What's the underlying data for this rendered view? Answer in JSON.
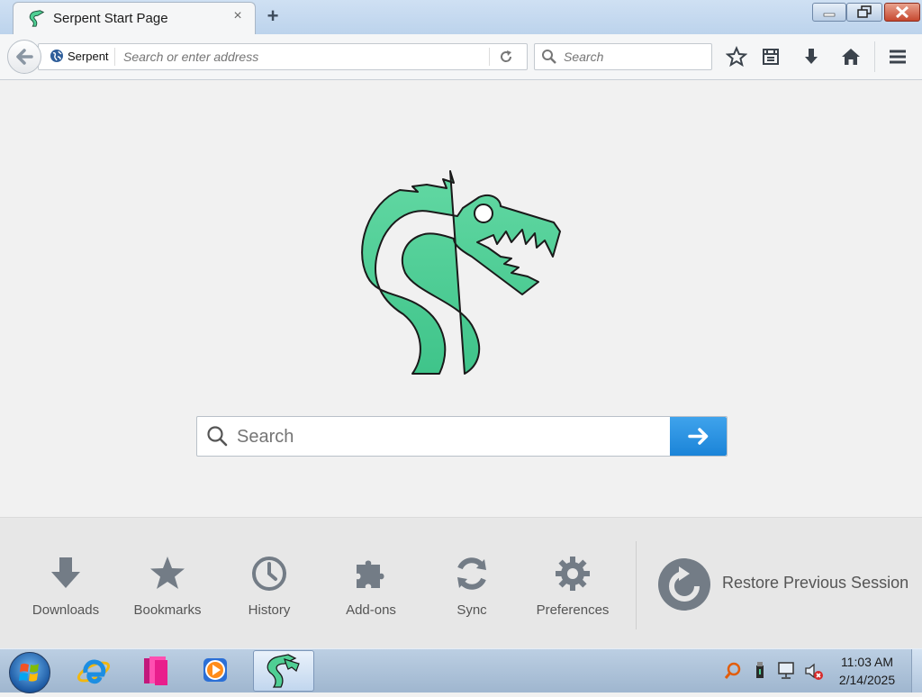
{
  "window": {
    "tab_title": "Serpent Start Page",
    "tab_close": "×",
    "new_tab": "+"
  },
  "navbar": {
    "identity_label": "Serpent",
    "url_placeholder": "Search or enter address",
    "search_placeholder": "Search"
  },
  "main": {
    "search_placeholder": "Search"
  },
  "launcher": {
    "items": [
      {
        "label": "Downloads",
        "icon": "download-icon"
      },
      {
        "label": "Bookmarks",
        "icon": "star-icon"
      },
      {
        "label": "History",
        "icon": "clock-icon"
      },
      {
        "label": "Add-ons",
        "icon": "puzzle-icon"
      },
      {
        "label": "Sync",
        "icon": "sync-icon"
      },
      {
        "label": "Preferences",
        "icon": "gear-icon"
      }
    ],
    "restore_label": "Restore Previous Session"
  },
  "taskbar": {
    "time": "11:03 AM",
    "date": "2/14/2025"
  },
  "colors": {
    "brand_green": "#4fcf94",
    "accent_blue": "#1b84d8",
    "icon_gray": "#737c86"
  }
}
